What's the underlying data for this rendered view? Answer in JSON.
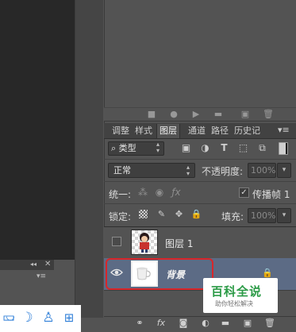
{
  "layers_panel": {
    "tabs": [
      "调整",
      "样式",
      "图层",
      "通道",
      "路径",
      "历史记"
    ],
    "active_tab": "图层",
    "filter_type": "类型",
    "blend_mode": "正常",
    "opacity_label": "不透明度:",
    "opacity_value": "100%",
    "unify_label": "统一:",
    "propagate_label": "传播帧 1",
    "lock_label": "锁定:",
    "fill_label": "填充:",
    "fill_value": "100%",
    "layers": [
      {
        "name": "图层 1",
        "visible": false,
        "locked": false
      },
      {
        "name": "背景",
        "visible": true,
        "locked": true,
        "selected": true
      }
    ]
  },
  "watermark": {
    "title": "百科全说",
    "subtitle": "助你轻松解决"
  },
  "colors": {
    "panel_bg": "#535353",
    "selected_row": "#5c6b85",
    "highlight_border": "#d8262a",
    "watermark_green": "#2c9b47",
    "taskbar_icon": "#2f7fd8"
  },
  "icons": {
    "taskbar": [
      "tray-icon",
      "coffee-icon",
      "moon-icon",
      "user-icon",
      "grid-icon"
    ],
    "bottom_bar": [
      "link-icon",
      "fx-icon",
      "mask-icon",
      "adjustment-icon",
      "folder-icon",
      "new-layer-icon",
      "trash-icon"
    ]
  }
}
